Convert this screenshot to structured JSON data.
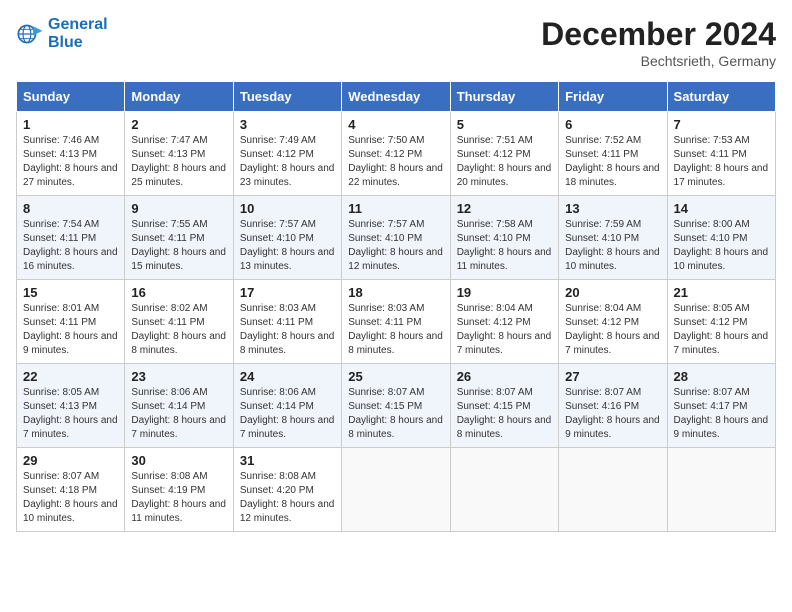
{
  "logo": {
    "line1": "General",
    "line2": "Blue"
  },
  "title": "December 2024",
  "location": "Bechtsrieth, Germany",
  "days_of_week": [
    "Sunday",
    "Monday",
    "Tuesday",
    "Wednesday",
    "Thursday",
    "Friday",
    "Saturday"
  ],
  "weeks": [
    [
      {
        "day": "1",
        "sunrise": "7:46 AM",
        "sunset": "4:13 PM",
        "daylight": "8 hours and 27 minutes."
      },
      {
        "day": "2",
        "sunrise": "7:47 AM",
        "sunset": "4:13 PM",
        "daylight": "8 hours and 25 minutes."
      },
      {
        "day": "3",
        "sunrise": "7:49 AM",
        "sunset": "4:12 PM",
        "daylight": "8 hours and 23 minutes."
      },
      {
        "day": "4",
        "sunrise": "7:50 AM",
        "sunset": "4:12 PM",
        "daylight": "8 hours and 22 minutes."
      },
      {
        "day": "5",
        "sunrise": "7:51 AM",
        "sunset": "4:12 PM",
        "daylight": "8 hours and 20 minutes."
      },
      {
        "day": "6",
        "sunrise": "7:52 AM",
        "sunset": "4:11 PM",
        "daylight": "8 hours and 18 minutes."
      },
      {
        "day": "7",
        "sunrise": "7:53 AM",
        "sunset": "4:11 PM",
        "daylight": "8 hours and 17 minutes."
      }
    ],
    [
      {
        "day": "8",
        "sunrise": "7:54 AM",
        "sunset": "4:11 PM",
        "daylight": "8 hours and 16 minutes."
      },
      {
        "day": "9",
        "sunrise": "7:55 AM",
        "sunset": "4:11 PM",
        "daylight": "8 hours and 15 minutes."
      },
      {
        "day": "10",
        "sunrise": "7:57 AM",
        "sunset": "4:10 PM",
        "daylight": "8 hours and 13 minutes."
      },
      {
        "day": "11",
        "sunrise": "7:57 AM",
        "sunset": "4:10 PM",
        "daylight": "8 hours and 12 minutes."
      },
      {
        "day": "12",
        "sunrise": "7:58 AM",
        "sunset": "4:10 PM",
        "daylight": "8 hours and 11 minutes."
      },
      {
        "day": "13",
        "sunrise": "7:59 AM",
        "sunset": "4:10 PM",
        "daylight": "8 hours and 10 minutes."
      },
      {
        "day": "14",
        "sunrise": "8:00 AM",
        "sunset": "4:10 PM",
        "daylight": "8 hours and 10 minutes."
      }
    ],
    [
      {
        "day": "15",
        "sunrise": "8:01 AM",
        "sunset": "4:11 PM",
        "daylight": "8 hours and 9 minutes."
      },
      {
        "day": "16",
        "sunrise": "8:02 AM",
        "sunset": "4:11 PM",
        "daylight": "8 hours and 8 minutes."
      },
      {
        "day": "17",
        "sunrise": "8:03 AM",
        "sunset": "4:11 PM",
        "daylight": "8 hours and 8 minutes."
      },
      {
        "day": "18",
        "sunrise": "8:03 AM",
        "sunset": "4:11 PM",
        "daylight": "8 hours and 8 minutes."
      },
      {
        "day": "19",
        "sunrise": "8:04 AM",
        "sunset": "4:12 PM",
        "daylight": "8 hours and 7 minutes."
      },
      {
        "day": "20",
        "sunrise": "8:04 AM",
        "sunset": "4:12 PM",
        "daylight": "8 hours and 7 minutes."
      },
      {
        "day": "21",
        "sunrise": "8:05 AM",
        "sunset": "4:12 PM",
        "daylight": "8 hours and 7 minutes."
      }
    ],
    [
      {
        "day": "22",
        "sunrise": "8:05 AM",
        "sunset": "4:13 PM",
        "daylight": "8 hours and 7 minutes."
      },
      {
        "day": "23",
        "sunrise": "8:06 AM",
        "sunset": "4:14 PM",
        "daylight": "8 hours and 7 minutes."
      },
      {
        "day": "24",
        "sunrise": "8:06 AM",
        "sunset": "4:14 PM",
        "daylight": "8 hours and 7 minutes."
      },
      {
        "day": "25",
        "sunrise": "8:07 AM",
        "sunset": "4:15 PM",
        "daylight": "8 hours and 8 minutes."
      },
      {
        "day": "26",
        "sunrise": "8:07 AM",
        "sunset": "4:15 PM",
        "daylight": "8 hours and 8 minutes."
      },
      {
        "day": "27",
        "sunrise": "8:07 AM",
        "sunset": "4:16 PM",
        "daylight": "8 hours and 9 minutes."
      },
      {
        "day": "28",
        "sunrise": "8:07 AM",
        "sunset": "4:17 PM",
        "daylight": "8 hours and 9 minutes."
      }
    ],
    [
      {
        "day": "29",
        "sunrise": "8:07 AM",
        "sunset": "4:18 PM",
        "daylight": "8 hours and 10 minutes."
      },
      {
        "day": "30",
        "sunrise": "8:08 AM",
        "sunset": "4:19 PM",
        "daylight": "8 hours and 11 minutes."
      },
      {
        "day": "31",
        "sunrise": "8:08 AM",
        "sunset": "4:20 PM",
        "daylight": "8 hours and 12 minutes."
      },
      null,
      null,
      null,
      null
    ]
  ]
}
